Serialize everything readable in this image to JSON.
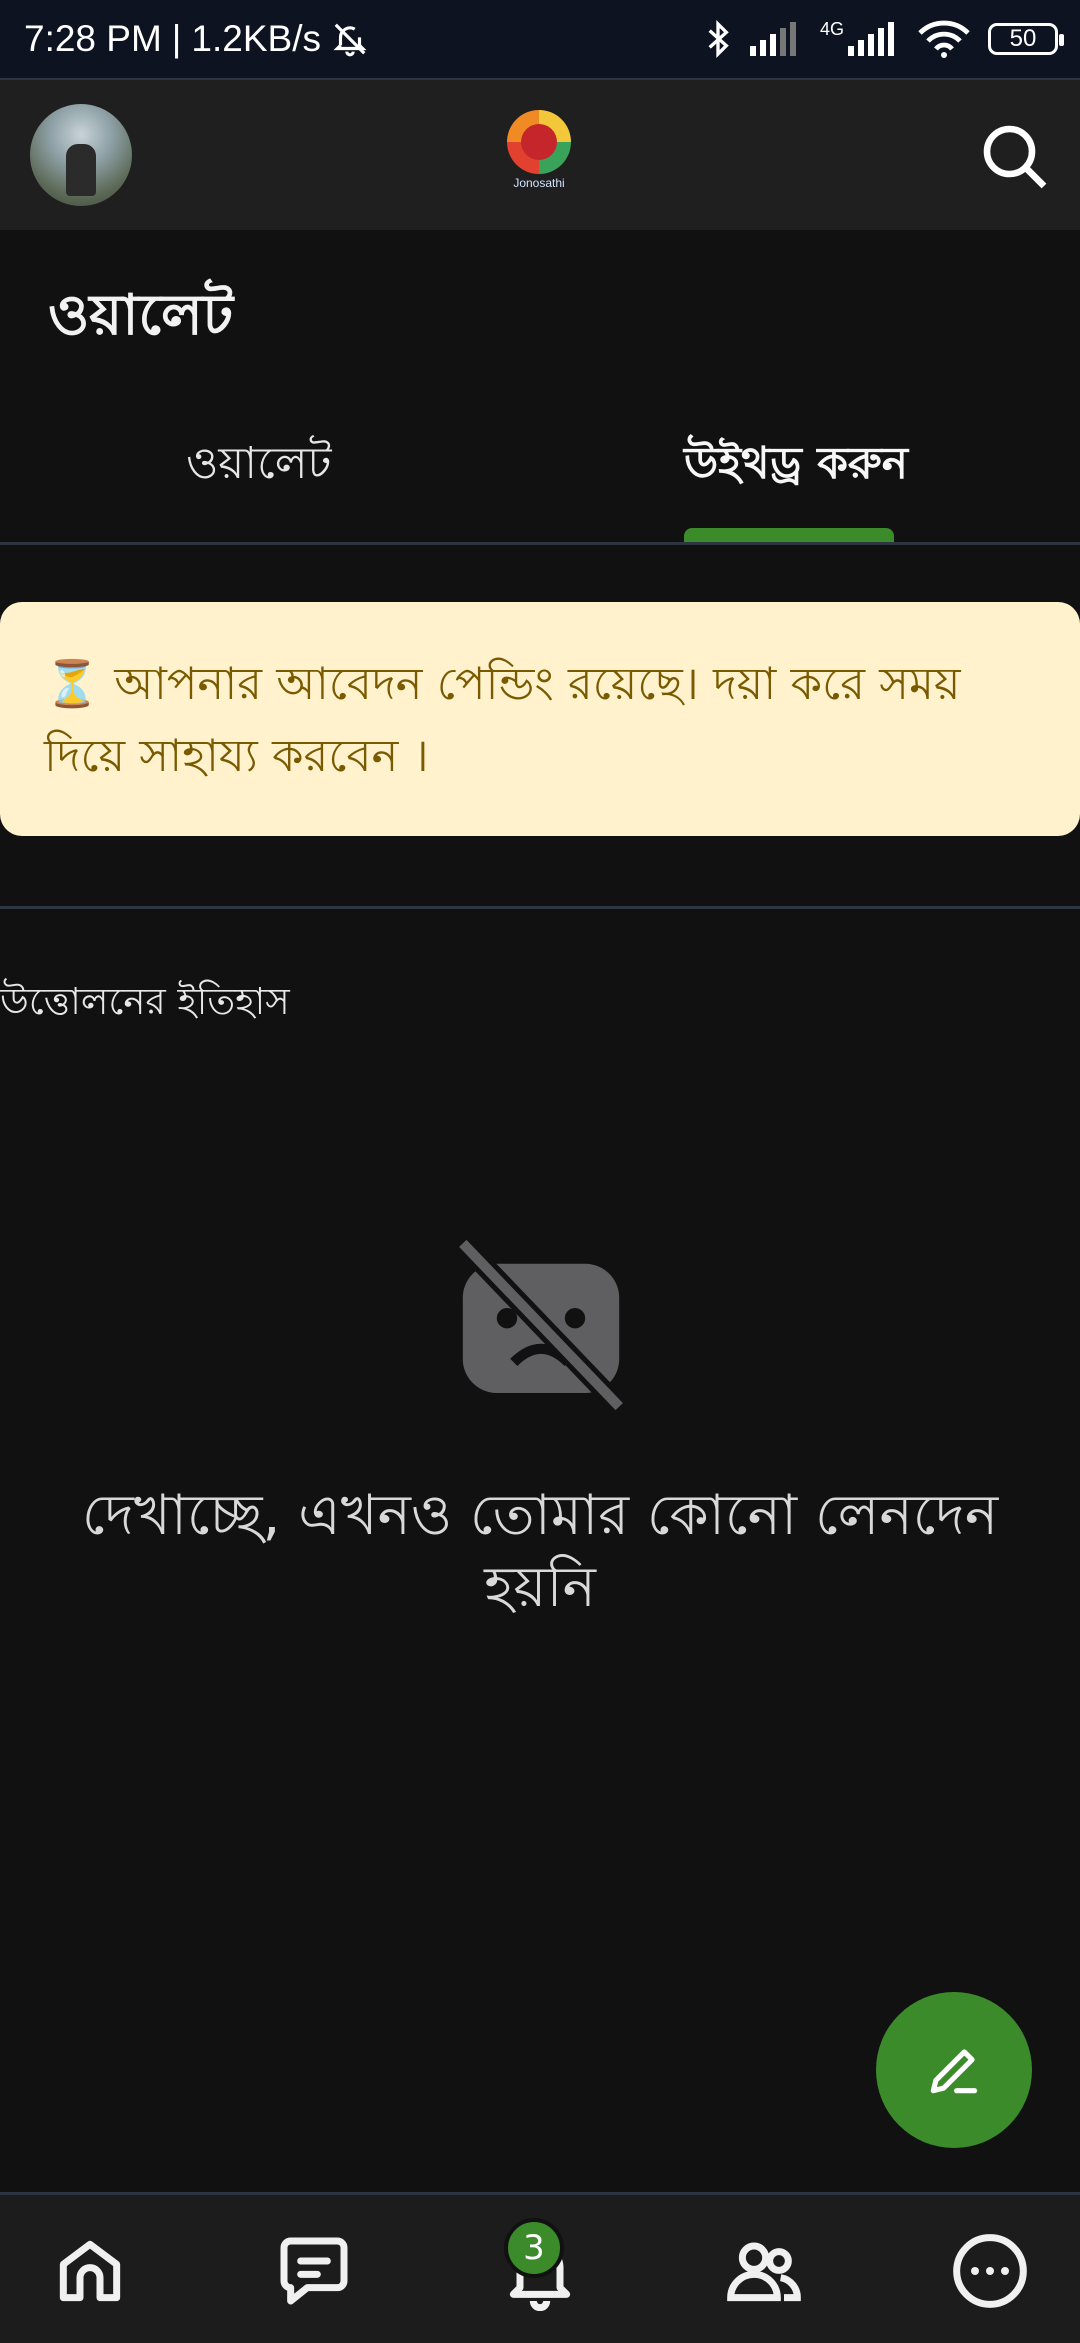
{
  "status_bar": {
    "time": "7:28 PM",
    "speed": "1.2KB/s",
    "network": "4G",
    "battery": "50"
  },
  "header": {
    "logo_text": "Jonosathi"
  },
  "page": {
    "title": "ওয়ালেট"
  },
  "tabs": [
    {
      "label": "ওয়ালেট",
      "active": false
    },
    {
      "label": "উইথড্র করুন",
      "active": true
    }
  ],
  "notice": {
    "icon": "⏳",
    "text": "আপনার আবেদন পেন্ডিং রয়েছে। দয়া করে সময় দিয়ে সাহায্য করবেন ।"
  },
  "history": {
    "label": "উত্তোলনের ইতিহাস",
    "empty_message": "দেখাচ্ছে, এখনও তোমার কোনো লেনদেন হয়নি"
  },
  "bottom_nav": {
    "notification_count": "3"
  },
  "colors": {
    "accent": "#3b8b2b",
    "notice_bg": "#fff2cc",
    "notice_text": "#7a5a00",
    "background": "#111112"
  }
}
